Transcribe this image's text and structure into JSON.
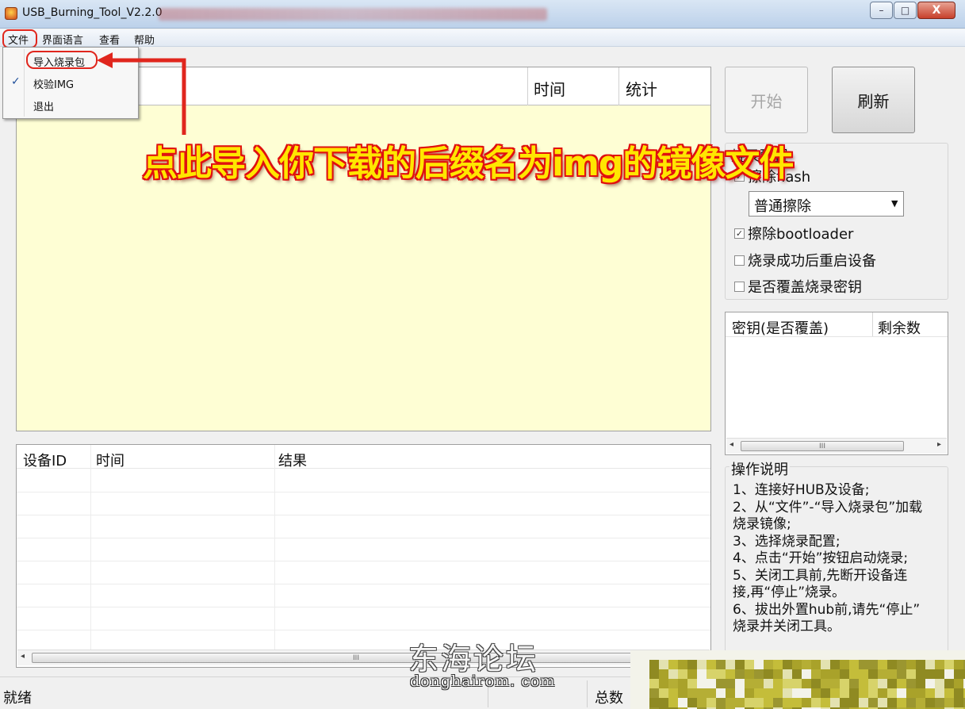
{
  "window": {
    "title": "USB_Burning_Tool_V2.2.0",
    "min_label": "–",
    "max_label": "□",
    "close_label": "X"
  },
  "menubar": {
    "items": [
      "文件",
      "界面语言",
      "查看",
      "帮助"
    ]
  },
  "file_menu": {
    "items": [
      {
        "label": "导入烧录包",
        "checked": false
      },
      {
        "label": "校验IMG",
        "checked": true
      },
      {
        "label": "退出",
        "checked": false
      }
    ],
    "check_glyph": "✓"
  },
  "annotation": "点此导入你下载的后缀名为img的镜像文件",
  "image_list": {
    "columns": [
      "时间",
      "统计"
    ]
  },
  "device_table": {
    "columns": [
      "设备ID",
      "时间",
      "结果"
    ],
    "scroll_grip": "III"
  },
  "buttons": {
    "start": "开始",
    "refresh": "刷新"
  },
  "burn_config": {
    "title": "烧录配置",
    "erase_flash": {
      "label": "擦除flash",
      "checked": true
    },
    "erase_mode": {
      "value": "普通擦除"
    },
    "erase_bootloader": {
      "label": "擦除bootloader",
      "checked": true
    },
    "reboot_after": {
      "label": "烧录成功后重启设备",
      "checked": false
    },
    "overwrite_key": {
      "label": "是否覆盖烧录密钥",
      "checked": false
    }
  },
  "key_table": {
    "columns": [
      "密钥(是否覆盖)",
      "剩余数"
    ],
    "scroll_grip": "III"
  },
  "instructions": {
    "title": "操作说明",
    "lines": [
      "1、连接好HUB及设备;",
      "2、从“文件”-“导入烧录包”加载",
      "烧录镜像;",
      "3、选择烧录配置;",
      "4、点击“开始”按钮启动烧录;",
      "5、关闭工具前,先断开设备连",
      "接,再“停止”烧录。",
      "6、拔出外置hub前,请先“停止”",
      "烧录并关闭工具。"
    ]
  },
  "statusbar": {
    "status": "就绪",
    "total_label": "总数"
  },
  "watermark": {
    "name": "东海论坛",
    "url": "donghairom. com"
  },
  "colors": {
    "annotation_fill": "#ffe600",
    "annotation_outline": "#e01010",
    "highlight_ring": "#e0261d",
    "image_list_bg": "#fefed4"
  }
}
